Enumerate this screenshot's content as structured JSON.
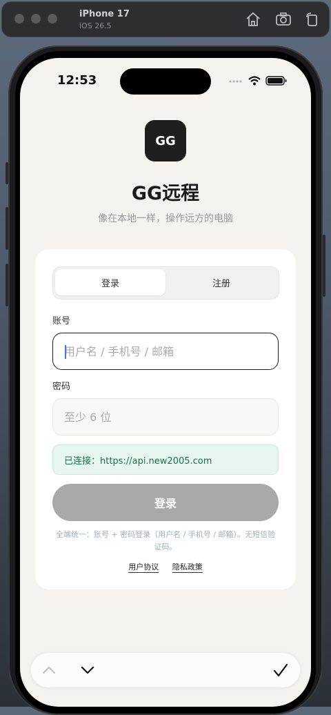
{
  "simulator": {
    "device_name": "iPhone 17",
    "os_version": "iOS 26.5"
  },
  "status_bar": {
    "time": "12:53"
  },
  "app": {
    "logo_text": "GG",
    "title": "GG远程",
    "subtitle": "像在本地一样，操作远方的电脑"
  },
  "auth_tabs": {
    "login": "登录",
    "register": "注册",
    "active": "login"
  },
  "account": {
    "label": "账号",
    "placeholder": "用户名 / 手机号 / 邮箱",
    "value": ""
  },
  "password": {
    "label": "密码",
    "placeholder": "至少 6 位",
    "value": ""
  },
  "connection": {
    "status_text": "已连接：https://api.new2005.com"
  },
  "login_button": {
    "label": "登录"
  },
  "hint": "全端统一：账号 + 密码登录（用户名 / 手机号 / 邮箱）。无短信验证码。",
  "links": {
    "terms": "用户协议",
    "privacy": "隐私政策"
  },
  "colors": {
    "screen_bg": "#f4f3ef",
    "connected_text": "#17744a",
    "connected_bg": "#e7f6ef",
    "button_disabled": "#a9a9a9",
    "caret": "#3d7bf6"
  },
  "keyboard_toolbar": {
    "icons": [
      "chevron-up-icon",
      "chevron-down-icon",
      "checkmark-icon"
    ]
  }
}
